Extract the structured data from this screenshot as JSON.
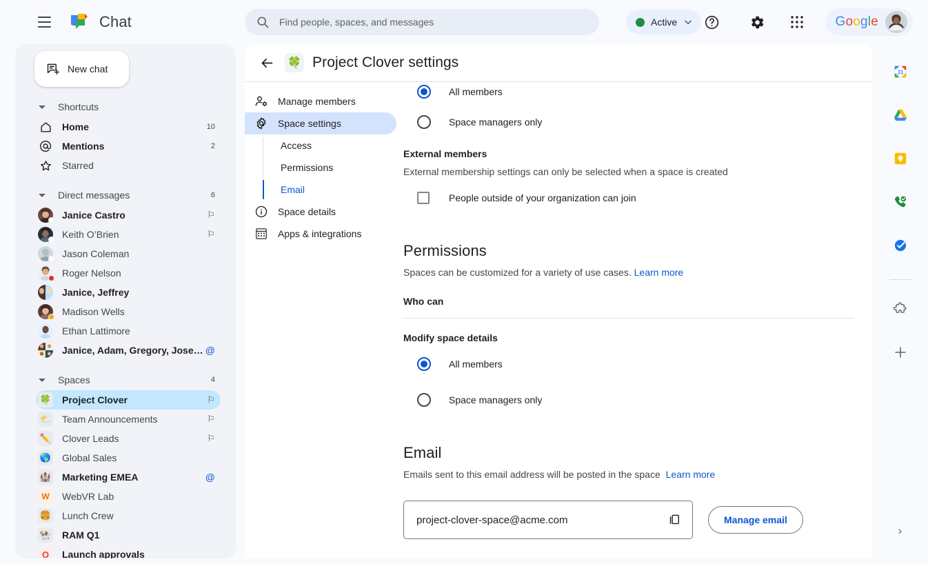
{
  "app": {
    "brand": "Chat",
    "google_word": "Google"
  },
  "search": {
    "placeholder": "Find people, spaces, and messages",
    "value": ""
  },
  "header": {
    "status_label": "Active",
    "status_color": "#1e8e3e"
  },
  "sidebar": {
    "new_chat_label": "New chat",
    "sections": [
      {
        "title": "Shortcuts",
        "count": "",
        "items": [
          {
            "label": "Home",
            "bold": true,
            "trailing": "10",
            "trailing_type": "count",
            "icon": "home-icon"
          },
          {
            "label": "Mentions",
            "bold": true,
            "trailing": "2",
            "trailing_type": "count",
            "icon": "at-icon"
          },
          {
            "label": "Starred",
            "bold": false,
            "trailing": "",
            "trailing_type": "",
            "icon": "star-icon"
          }
        ]
      },
      {
        "title": "Direct messages",
        "count": "6",
        "items": [
          {
            "label": "Janice Castro",
            "bold": true,
            "trailing": "⚐",
            "trailing_type": "pin",
            "presence": "active"
          },
          {
            "label": "Keith O’Brien",
            "bold": false,
            "trailing": "⚐",
            "trailing_type": "pin",
            "presence": "active"
          },
          {
            "label": "Jason Coleman",
            "bold": false,
            "trailing": "",
            "trailing_type": "",
            "presence": "active"
          },
          {
            "label": "Roger Nelson",
            "bold": false,
            "trailing": "",
            "trailing_type": "",
            "presence": "busy"
          },
          {
            "label": "Janice, Jeffrey",
            "bold": true,
            "trailing": "",
            "trailing_type": "",
            "presence": "none"
          },
          {
            "label": "Madison Wells",
            "bold": false,
            "trailing": "",
            "trailing_type": "",
            "presence": "away"
          },
          {
            "label": "Ethan Lattimore",
            "bold": false,
            "trailing": "",
            "trailing_type": "",
            "presence": "none"
          },
          {
            "label": "Janice, Adam, Gregory, Jose…",
            "bold": true,
            "trailing": "@",
            "trailing_type": "at",
            "presence": "none"
          }
        ]
      },
      {
        "title": "Spaces",
        "count": "4",
        "items": [
          {
            "label": "Project Clover",
            "bold": true,
            "trailing": "⚐",
            "trailing_type": "pin",
            "emoji": "🍀",
            "selected": true
          },
          {
            "label": "Team Announcements",
            "bold": false,
            "trailing": "⚐",
            "trailing_type": "pin",
            "emoji": "⛅"
          },
          {
            "label": "Clover Leads",
            "bold": false,
            "trailing": "⚐",
            "trailing_type": "pin",
            "emoji": "✏️"
          },
          {
            "label": "Global Sales",
            "bold": false,
            "trailing": "",
            "trailing_type": "",
            "emoji": "🌎"
          },
          {
            "label": "Marketing EMEA",
            "bold": true,
            "trailing": "@",
            "trailing_type": "at",
            "emoji": "🏰"
          },
          {
            "label": "WebVR Lab",
            "bold": false,
            "trailing": "",
            "trailing_type": "",
            "emoji": "W",
            "tile": "lt"
          },
          {
            "label": "Lunch Crew",
            "bold": false,
            "trailing": "",
            "trailing_type": "",
            "emoji": "🍔"
          },
          {
            "label": "RAM Q1",
            "bold": true,
            "trailing": "",
            "trailing_type": "",
            "emoji": "🐏"
          },
          {
            "label": "Launch approvals",
            "bold": true,
            "trailing": "",
            "trailing_type": "",
            "emoji": "O",
            "tile": "o"
          }
        ]
      }
    ]
  },
  "main": {
    "space_emoji": "🍀",
    "title": "Project Clover settings",
    "nav": [
      {
        "label": "Manage members",
        "icon": "manage-members-icon",
        "selected": false
      },
      {
        "label": "Space settings",
        "icon": "gear-icon",
        "selected": true
      }
    ],
    "sub_nav": [
      {
        "label": "Access",
        "active": false
      },
      {
        "label": "Permissions",
        "active": false
      },
      {
        "label": "Email",
        "active": true
      }
    ],
    "nav_after": [
      {
        "label": "Space details",
        "icon": "info-icon",
        "selected": false
      },
      {
        "label": "Apps & integrations",
        "icon": "apps-grid-icon",
        "selected": false
      }
    ]
  },
  "access_section": {
    "options": [
      {
        "label": "All members",
        "selected": true
      },
      {
        "label": "Space managers only",
        "selected": false
      }
    ],
    "external_heading": "External members",
    "external_desc": "External membership settings can only be selected when a space is created",
    "external_checkbox_label": "People outside of your organization can join",
    "external_checked": false
  },
  "permissions_section": {
    "title": "Permissions",
    "desc": "Spaces can be customized for a variety of use cases.",
    "learn_more": "Learn more",
    "who_can": "Who can",
    "group_label": "Modify space details",
    "options": [
      {
        "label": "All members",
        "selected": true
      },
      {
        "label": "Space managers only",
        "selected": false
      }
    ]
  },
  "email_section": {
    "title": "Email",
    "desc": "Emails sent to this email address will be posted in the space",
    "learn_more": "Learn more",
    "address": "project-clover-space@acme.com",
    "manage_label": "Manage email"
  },
  "rail": {
    "items": [
      {
        "name": "calendar-icon"
      },
      {
        "name": "drive-icon"
      },
      {
        "name": "keep-icon"
      },
      {
        "name": "voice-icon"
      },
      {
        "name": "tasks-icon"
      }
    ],
    "after": [
      {
        "name": "marketplace-puzzle-icon"
      },
      {
        "name": "add-icon"
      }
    ],
    "expand": "›"
  }
}
